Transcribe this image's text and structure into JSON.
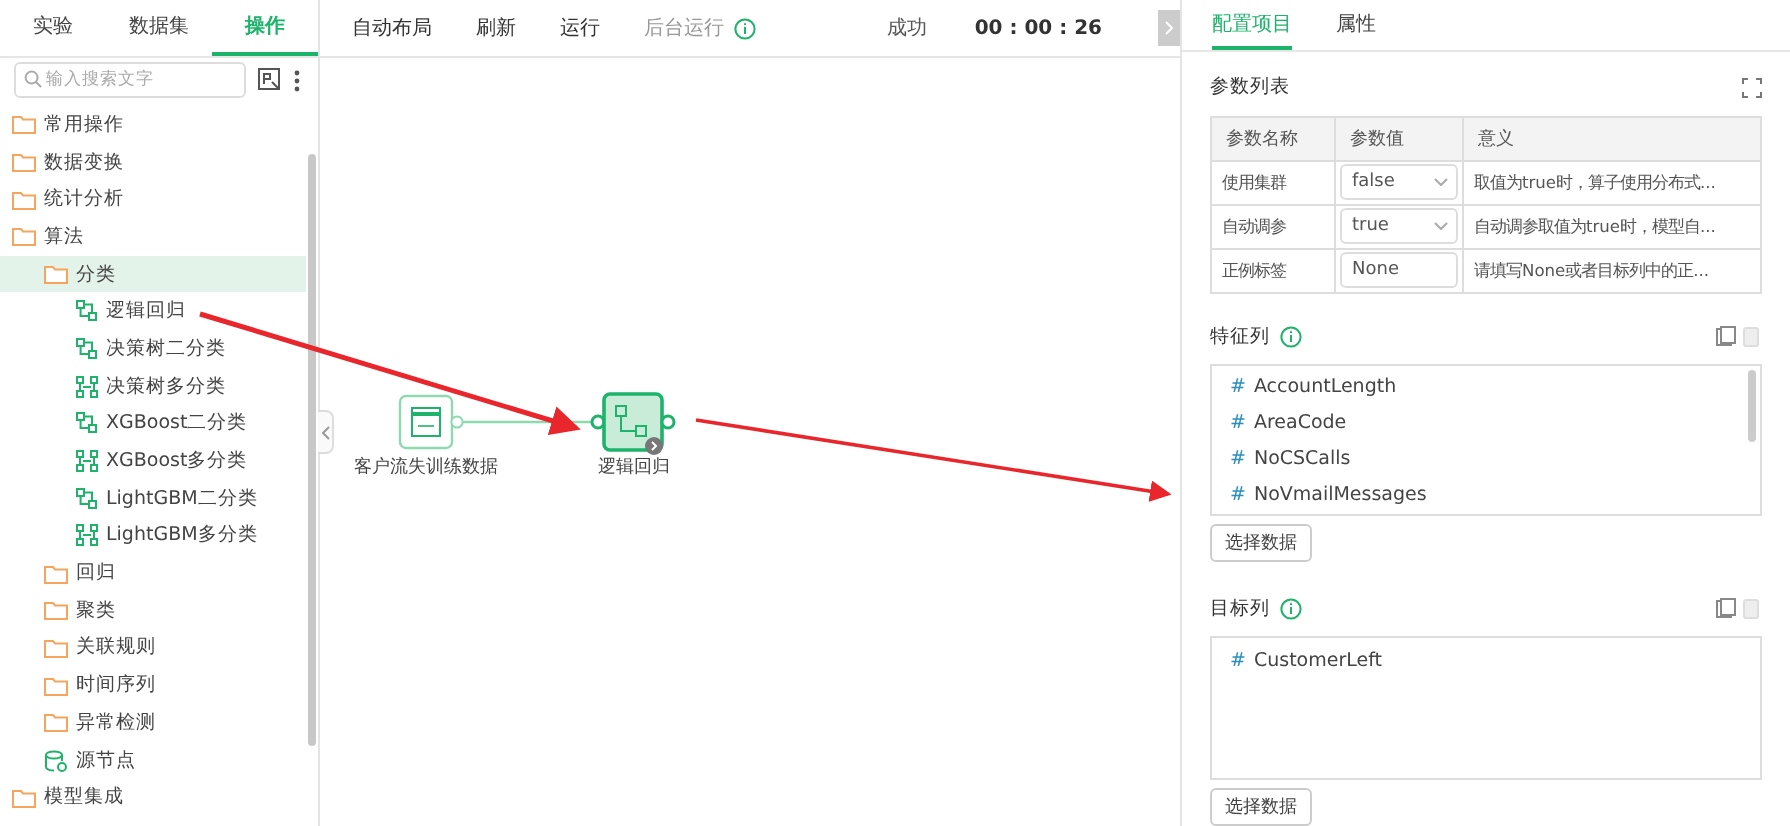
{
  "sidebar": {
    "tabs": [
      {
        "label": "实验",
        "selected": false
      },
      {
        "label": "数据集",
        "selected": false
      },
      {
        "label": "操作",
        "selected": true
      }
    ],
    "search": {
      "placeholder": "输入搜索文字"
    },
    "tree": [
      {
        "label": "常用操作",
        "kind": "folder",
        "selected": false
      },
      {
        "label": "数据变换",
        "kind": "folder",
        "selected": false
      },
      {
        "label": "统计分析",
        "kind": "folder",
        "selected": false
      },
      {
        "label": "算法",
        "kind": "folder",
        "selected": false,
        "children": [
          {
            "label": "分类",
            "kind": "folder",
            "selected": true,
            "children": [
              {
                "label": "逻辑回归",
                "kind": "binary",
                "selected": false
              },
              {
                "label": "决策树二分类",
                "kind": "binary",
                "selected": false
              },
              {
                "label": "决策树多分类",
                "kind": "multi",
                "selected": false
              },
              {
                "label": "XGBoost二分类",
                "kind": "binary",
                "selected": false
              },
              {
                "label": "XGBoost多分类",
                "kind": "multi",
                "selected": false
              },
              {
                "label": "LightGBM二分类",
                "kind": "binary",
                "selected": false
              },
              {
                "label": "LightGBM多分类",
                "kind": "multi",
                "selected": false
              }
            ]
          },
          {
            "label": "回归",
            "kind": "folder",
            "selected": false
          },
          {
            "label": "聚类",
            "kind": "folder",
            "selected": false
          },
          {
            "label": "关联规则",
            "kind": "folder",
            "selected": false
          },
          {
            "label": "时间序列",
            "kind": "folder",
            "selected": false
          },
          {
            "label": "异常检测",
            "kind": "folder",
            "selected": false
          },
          {
            "label": "源节点",
            "kind": "source",
            "selected": false
          }
        ]
      },
      {
        "label": "模型集成",
        "kind": "folder",
        "selected": false
      }
    ]
  },
  "toolbar": {
    "actions": [
      {
        "label": "自动布局",
        "disabled": false
      },
      {
        "label": "刷新",
        "disabled": false
      },
      {
        "label": "运行",
        "disabled": false
      },
      {
        "label": "后台运行",
        "disabled": true
      }
    ],
    "status": "成功",
    "timer": "00 : 00 : 26"
  },
  "canvas": {
    "nodes": [
      {
        "label": "客户流失训练数据",
        "kind": "sql",
        "selected": false
      },
      {
        "label": "逻辑回归",
        "kind": "model",
        "selected": true
      }
    ]
  },
  "panel": {
    "tabs": [
      {
        "label": "配置项目",
        "selected": true
      },
      {
        "label": "属性",
        "selected": false
      }
    ],
    "params_title": "参数列表",
    "columns": [
      "参数名称",
      "参数值",
      "意义"
    ],
    "rows": [
      {
        "name": "使用集群",
        "kind": "select",
        "value": "false",
        "meaning": "取值为true时，算子使用分布式..."
      },
      {
        "name": "自动调参",
        "kind": "select",
        "value": "true",
        "meaning": "自动调参取值为true时，模型自..."
      },
      {
        "name": "正例标签",
        "kind": "input",
        "value": "None",
        "meaning": "请填写None或者目标列中的正..."
      }
    ],
    "feature_title": "特征列",
    "features": [
      {
        "icon": "#",
        "name": "AccountLength"
      },
      {
        "icon": "#",
        "name": "AreaCode"
      },
      {
        "icon": "#",
        "name": "NoCSCalls"
      },
      {
        "icon": "#",
        "name": "NoVmailMessages"
      }
    ],
    "select_button": "选择数据",
    "target_title": "目标列",
    "targets": [
      {
        "icon": "#",
        "name": "CustomerLeft"
      }
    ],
    "target_button": "选择数据"
  }
}
